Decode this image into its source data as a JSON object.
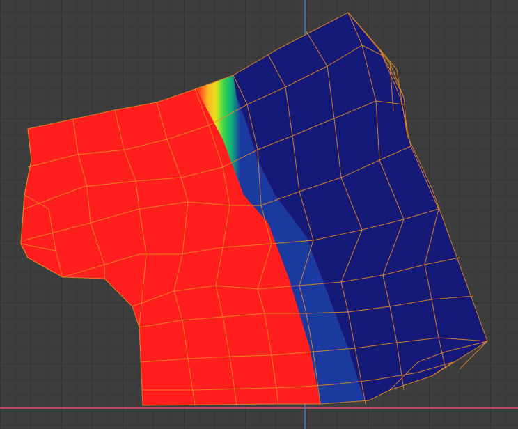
{
  "viewport": {
    "background_color": "#3d3d3d",
    "grid_color": "#333333",
    "axis_x_color": "#b84a55",
    "axis_y_color": "#3f6aa8"
  },
  "mesh": {
    "wire_color": "#e58a1f",
    "gradient_stops": [
      {
        "offset": 0.0,
        "color": "#ff1e1e"
      },
      {
        "offset": 0.36,
        "color": "#ff1e1e"
      },
      {
        "offset": 0.385,
        "color": "#ffb020"
      },
      {
        "offset": 0.4,
        "color": "#e7e21d"
      },
      {
        "offset": 0.415,
        "color": "#3bd84a"
      },
      {
        "offset": 0.43,
        "color": "#0fb07a"
      },
      {
        "offset": 0.445,
        "color": "#2060b0"
      },
      {
        "offset": 0.46,
        "color": "#151a78"
      },
      {
        "offset": 1.0,
        "color": "#151a78"
      }
    ],
    "left_region_color": "#ff1e1e",
    "right_region_color": "#151a78"
  }
}
